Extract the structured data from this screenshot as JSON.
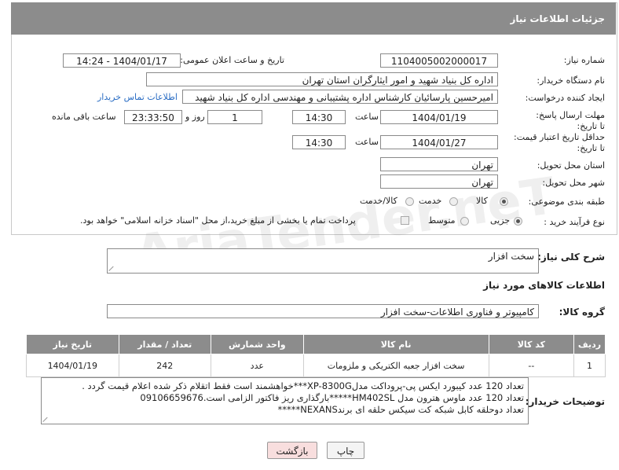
{
  "header": {
    "title": "جزئیات اطلاعات نیاز"
  },
  "fields": {
    "need_number_label": "شماره نیاز:",
    "need_number": "1104005002000017",
    "announce_label": "تاریخ و ساعت اعلان عمومی:",
    "announce_value": "1404/01/17 - 14:24",
    "buyer_label": "نام دستگاه خریدار:",
    "buyer_value": "اداره کل بنیاد شهید و امور ایثارگران استان تهران",
    "creator_label": "ایجاد کننده درخواست:",
    "creator_value": "امیرحسین پارسائیان کارشناس اداره پشتیبانی و مهندسی  اداره کل بنیاد شهید",
    "contact_link": "اطلاعات تماس خریدار",
    "deadline_label": "مهلت ارسال پاسخ: تا تاریخ:",
    "deadline_date": "1404/01/19",
    "time_label": "ساعت",
    "deadline_time": "14:30",
    "days_value": "1",
    "days_label": "روز و",
    "remaining_time": "23:33:50",
    "remaining_label": "ساعت باقی مانده",
    "price_validity_label": "حداقل تاریخ اعتبار قیمت: تا تاریخ:",
    "price_date": "1404/01/27",
    "price_time": "14:30",
    "province_label": "استان محل تحویل:",
    "province_value": "تهران",
    "city_label": "شهر محل تحویل:",
    "city_value": "تهران",
    "category_label": "طبقه بندی موضوعی:",
    "category_options": [
      "کالا",
      "خدمت",
      "کالا/خدمت"
    ],
    "process_label": "نوع فرآیند خرید :",
    "process_options": [
      "جزیی",
      "متوسط"
    ],
    "payment_note": "پرداخت تمام یا بخشی از مبلغ خرید،از محل \"اسناد خزانه اسلامی\" خواهد بود."
  },
  "summary": {
    "label": "شرح کلی نیاز:",
    "value": "سخت افزار"
  },
  "goods_section": {
    "title": "اطلاعات کالاهای مورد نیاز",
    "group_label": "گروه کالا:",
    "group_value": "کامپیوتر و فناوری اطلاعات-سخت افزار"
  },
  "table": {
    "headers": [
      "ردیف",
      "کد کالا",
      "نام کالا",
      "واحد شمارش",
      "تعداد / مقدار",
      "تاریخ نیاز"
    ],
    "rows": [
      [
        "1",
        "--",
        "سخت افزار جعبه الکتریکی و ملزومات",
        "عدد",
        "242",
        "1404/01/19"
      ]
    ]
  },
  "buyer_notes": {
    "label": "توضیحات خریدار:",
    "lines": [
      "تعداد 120 عدد کیبورد ایکس پی-پروداکت مدلXP-8300G***خواهشمند است فقط اتقلام ذکر شده اعلام قیمت گردد .",
      "تعداد 120 عدد ماوس هترون مدل HM402SL*****بارگذاری ریز فاکتور الزامی است.09106659676",
      "تعداد دوحلقه کابل شبکه کت سیکس حلقه ای برندNEXANS*****"
    ]
  },
  "buttons": {
    "print": "چاپ",
    "back": "بازگشت"
  },
  "watermark": "AriaTender.neT",
  "colors": {
    "header_bg": "#8c8c8c",
    "link": "#2a6dc4",
    "back_button_bg": "#f8dede"
  }
}
